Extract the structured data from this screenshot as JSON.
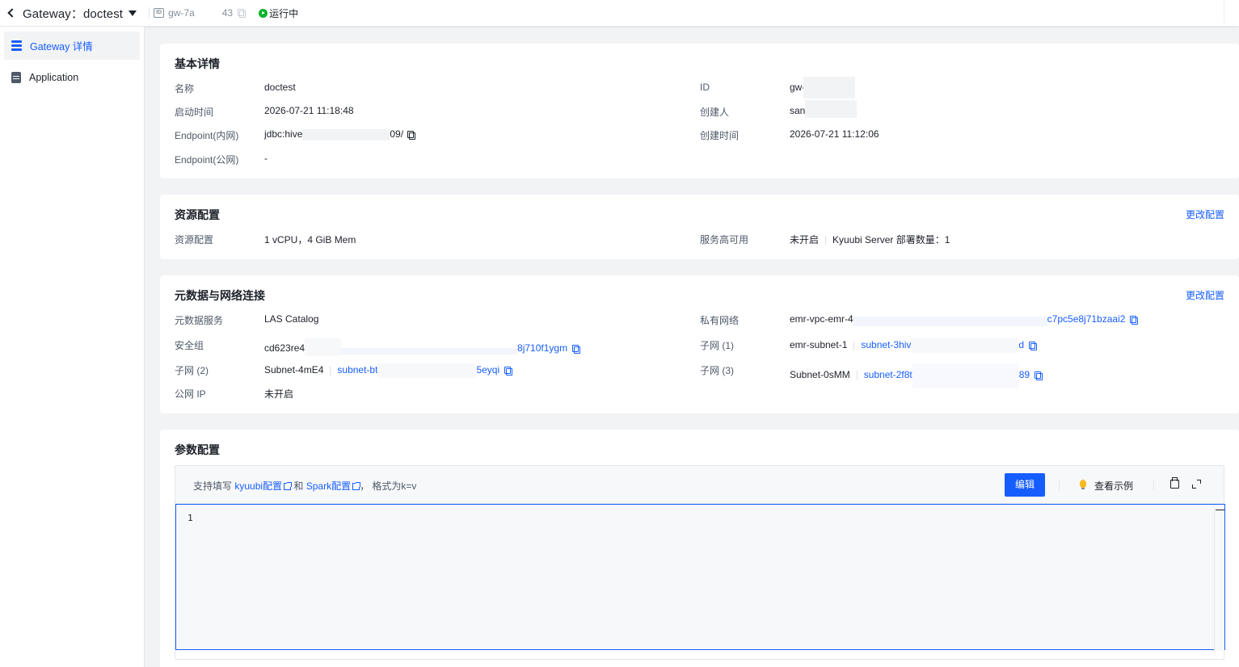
{
  "header": {
    "title": "Gateway：doctest",
    "id_prefix": "gw-7a",
    "id_suffix": "43",
    "status": "运行中"
  },
  "sidebar": {
    "items": [
      {
        "label": "Gateway 详情",
        "active": true,
        "icon": "stack-icon"
      },
      {
        "label": "Application",
        "active": false,
        "icon": "document-icon"
      }
    ]
  },
  "basic": {
    "title": "基本详情",
    "name_label": "名称",
    "name_value": "doctest",
    "start_label": "启动时间",
    "start_value": "2026-07-21 11:18:48",
    "endpoint_internal_label": "Endpoint(内网)",
    "endpoint_internal_prefix": "jdbc:hive",
    "endpoint_internal_suffix": "09/",
    "endpoint_public_label": "Endpoint(公网)",
    "endpoint_public_value": "-",
    "id_label": "ID",
    "id_value": "gw-",
    "creator_label": "创建人",
    "creator_value": "san",
    "created_label": "创建时间",
    "created_value": "2026-07-21 11:12:06"
  },
  "resource": {
    "title": "资源配置",
    "edit": "更改配置",
    "res_label": "资源配置",
    "res_value": "1 vCPU，4 GiB Mem",
    "ha_label": "服务高可用",
    "ha_status": "未开启",
    "ha_detail": "Kyuubi Server 部署数量：1"
  },
  "network": {
    "title": "元数据与网络连接",
    "edit": "更改配置",
    "meta_label": "元数据服务",
    "meta_value": "LAS Catalog",
    "sg_label": "安全组",
    "sg_prefix": "cd623re4",
    "sg_suffix": "8j710f1ygm",
    "subnet2_label": "子网 (2)",
    "subnet2_name": "Subnet-4mE4",
    "subnet2_id_prefix": "subnet-bt",
    "subnet2_id_suffix": "5eyqi",
    "eip_label": "公网 IP",
    "eip_value": "未开启",
    "vpc_label": "私有网络",
    "vpc_prefix": "emr-vpc-emr-4",
    "vpc_suffix": "c7pc5e8j71bzaai2",
    "subnet1_label": "子网 (1)",
    "subnet1_name": "emr-subnet-1",
    "subnet1_id_prefix": "subnet-3hiv",
    "subnet1_id_suffix": "d",
    "subnet3_label": "子网 (3)",
    "subnet3_name": "Subnet-0sMM",
    "subnet3_id_prefix": "subnet-2f8t",
    "subnet3_id_suffix": "89"
  },
  "params": {
    "title": "参数配置",
    "hint_prefix": "支持填写 ",
    "kyuubi_link": "kyuubi配置",
    "hint_and": " 和 ",
    "spark_link": "Spark配置",
    "hint_suffix": "， 格式为k=v",
    "edit_button": "编辑",
    "example": "查看示例",
    "line_number": "1"
  },
  "colors": {
    "primary": "#165dff",
    "success": "#00b42a",
    "bg": "#f2f3f5"
  }
}
